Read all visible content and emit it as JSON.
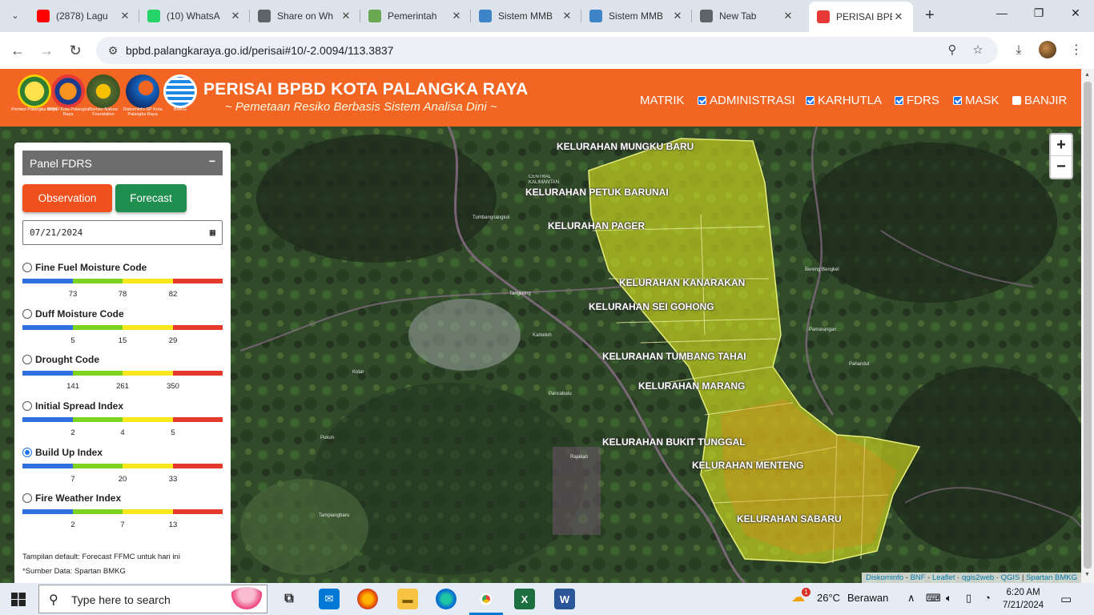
{
  "browser": {
    "tabs": [
      {
        "title": "(2878) Lagu",
        "icon": "youtube-icon",
        "color": "#ff0000"
      },
      {
        "title": "(10) WhatsA",
        "icon": "whatsapp-icon",
        "color": "#25d366"
      },
      {
        "title": "Share on Wh",
        "icon": "globe-icon",
        "color": "#5f6368"
      },
      {
        "title": "Pemerintah",
        "icon": "shield-icon",
        "color": "#6aa84f"
      },
      {
        "title": "Sistem MMB",
        "icon": "map-icon",
        "color": "#3d85c6"
      },
      {
        "title": "Sistem MMB",
        "icon": "map-icon",
        "color": "#3d85c6"
      },
      {
        "title": "New Tab",
        "icon": "chrome-icon",
        "color": "#5f6368"
      },
      {
        "title": "PERISAI BPBD",
        "icon": "bpbd-icon",
        "color": "#e53935"
      }
    ],
    "url": "bpbd.palangkaraya.go.id/perisai#10/-2.0094/113.3837"
  },
  "header": {
    "title": "PERISAI BPBD KOTA PALANGKA RAYA",
    "subtitle": "~ Pemetaan Resiko Berbasis Sistem Analisa Dini ~",
    "logos": [
      {
        "caption": "Pemkot Palangka Raya"
      },
      {
        "caption": "BPBD Kota Palangka Raya"
      },
      {
        "caption": "Borneo Nature Foundation"
      },
      {
        "caption": "Diskominfo-SP Kota Palangka Raya"
      },
      {
        "caption": "BMKG"
      }
    ],
    "nav": [
      {
        "label": "MATRIK",
        "checkbox": false,
        "checked": false
      },
      {
        "label": "ADMINISTRASI",
        "checkbox": true,
        "checked": true
      },
      {
        "label": "KARHUTLA",
        "checkbox": true,
        "checked": true
      },
      {
        "label": "FDRS",
        "checkbox": true,
        "checked": true
      },
      {
        "label": "MASK",
        "checkbox": true,
        "checked": true
      },
      {
        "label": "BANJIR",
        "checkbox": true,
        "checked": false
      }
    ]
  },
  "panel": {
    "title": "Panel FDRS",
    "collapse": "−",
    "observation_label": "Observation",
    "forecast_label": "Forecast",
    "date": "07/21/2024",
    "bar_colors": [
      "#2f6fe0",
      "#7ed321",
      "#f8e71c",
      "#e53a2b"
    ],
    "indices": [
      {
        "name": "Fine Fuel Moisture Code",
        "ticks": [
          "73",
          "78",
          "82"
        ],
        "selected": false
      },
      {
        "name": "Duff Moisture Code",
        "ticks": [
          "5",
          "15",
          "29"
        ],
        "selected": false
      },
      {
        "name": "Drought Code",
        "ticks": [
          "141",
          "261",
          "350"
        ],
        "selected": false
      },
      {
        "name": "Initial Spread Index",
        "ticks": [
          "2",
          "4",
          "5"
        ],
        "selected": false
      },
      {
        "name": "Build Up Index",
        "ticks": [
          "7",
          "20",
          "33"
        ],
        "selected": true
      },
      {
        "name": "Fire Weather Index",
        "ticks": [
          "2",
          "7",
          "13"
        ],
        "selected": false
      }
    ],
    "note_default": "Tampilan default: Forecast FFMC untuk hari ini",
    "note_source": "*Sumber Data: Spartan BMKG"
  },
  "map": {
    "labels": [
      "KELURAHAN MUNGKU BARU",
      "KELURAHAN PETUK BARUNAI",
      "KELURAHAN PAGER",
      "KELURAHAN KANARAKAN",
      "KELURAHAN SEI GOHONG",
      "KELURAHAN TUMBANG TAHAI",
      "KELURAHAN MARANG",
      "KELURAHAN BUKIT TUNGGAL",
      "KELURAHAN MENTENG",
      "KELURAHAN SABARU"
    ],
    "zoom_in": "+",
    "zoom_out": "−",
    "attribution": [
      "Diskominfo",
      "BNF",
      "Leaflet",
      "qgis2web",
      "QGIS",
      "Spartan BMKG"
    ]
  },
  "taskbar": {
    "search_placeholder": "Type here to search",
    "weather_temp": "26°C",
    "weather_desc": "Berawan",
    "weather_badge": "1",
    "time": "6:20 AM",
    "date": "7/21/2024"
  }
}
